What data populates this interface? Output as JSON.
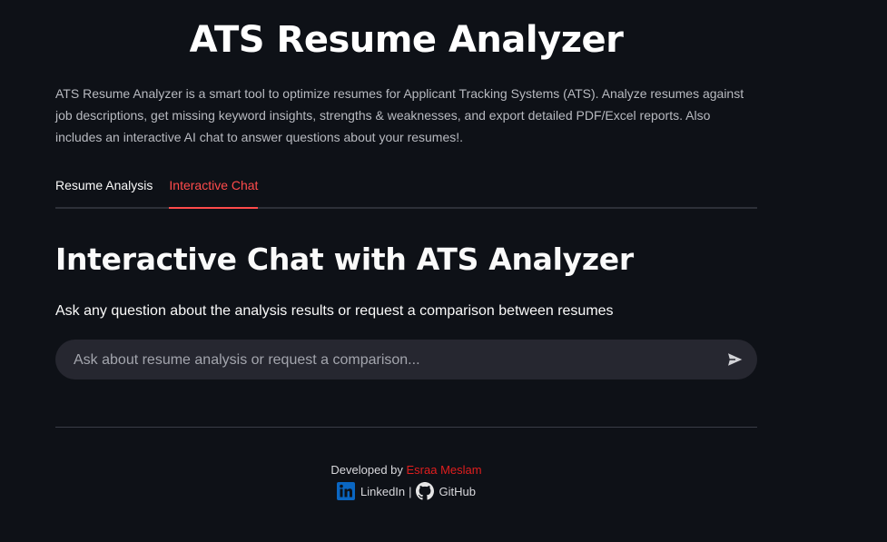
{
  "header": {
    "title": "ATS Resume Analyzer",
    "description": "ATS Resume Analyzer is a smart tool to optimize resumes for Applicant Tracking Systems (ATS). Analyze resumes against job descriptions, get missing keyword insights, strengths & weaknesses, and export detailed PDF/Excel reports. Also includes an interactive AI chat to answer questions about your resumes!."
  },
  "tabs": [
    {
      "label": "Resume Analysis",
      "active": false
    },
    {
      "label": "Interactive Chat",
      "active": true
    }
  ],
  "chat": {
    "heading": "Interactive Chat with ATS Analyzer",
    "subtitle": "Ask any question about the analysis results or request a comparison between resumes",
    "input_placeholder": "Ask about resume analysis or request a comparison...",
    "input_value": "",
    "send_icon": "send-icon"
  },
  "footer": {
    "developed_by": "Developed by",
    "author": "Esraa Meslam",
    "linkedin_label": "LinkedIn",
    "separator": "|",
    "github_label": "GitHub",
    "linkedin_icon": "linkedin-icon",
    "github_icon": "github-icon"
  },
  "colors": {
    "background": "#0e1117",
    "accent": "#ff4b4b",
    "input_bg": "#262730",
    "author": "#e01e1e",
    "linkedin": "#0a66c2"
  }
}
